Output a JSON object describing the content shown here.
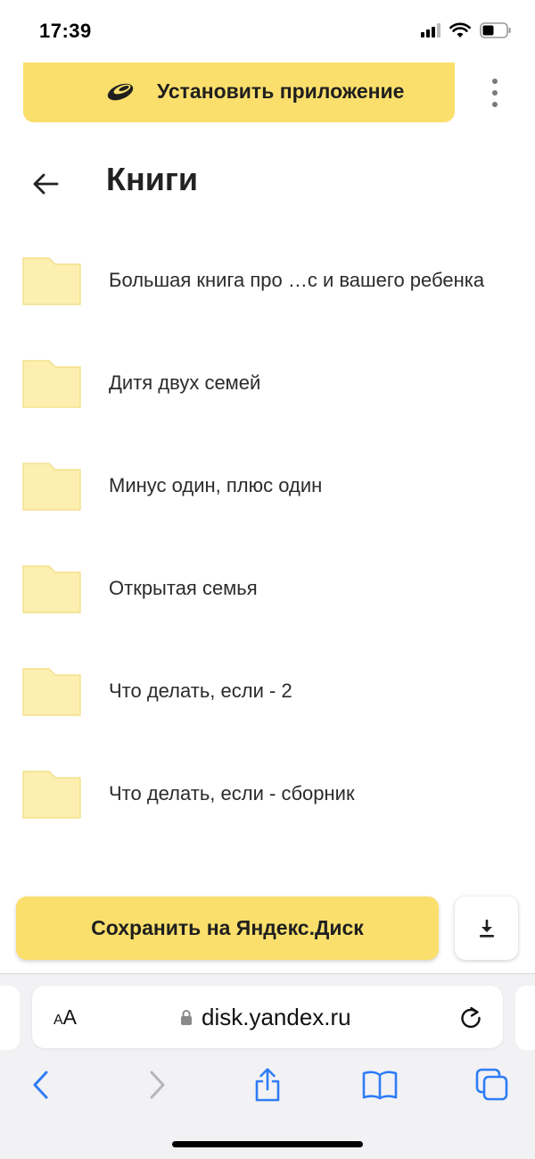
{
  "status_bar": {
    "time": "17:39"
  },
  "banner": {
    "label": "Установить приложение"
  },
  "header": {
    "title": "Книги"
  },
  "folders": [
    {
      "name": "Большая книга про …с и вашего ребенка"
    },
    {
      "name": "Дитя двух семей"
    },
    {
      "name": "Минус один, плюс один"
    },
    {
      "name": "Открытая семья"
    },
    {
      "name": "Что делать, если - 2"
    },
    {
      "name": "Что делать, если - сборник"
    }
  ],
  "actions": {
    "save_label": "Сохранить на Яндекс.Диск"
  },
  "browser": {
    "aa_small": "A",
    "aa_large": "A",
    "url": "disk.yandex.ru"
  },
  "colors": {
    "accent": "#fbdf6c",
    "folder": "#fcefb0",
    "ios_blue": "#2f7cf6"
  },
  "icons": {
    "status": [
      "signal-icon",
      "wifi-icon",
      "battery-icon"
    ],
    "toolbar": [
      "back-chevron-icon",
      "forward-chevron-icon",
      "share-icon",
      "bookmarks-icon",
      "tabs-icon"
    ]
  }
}
